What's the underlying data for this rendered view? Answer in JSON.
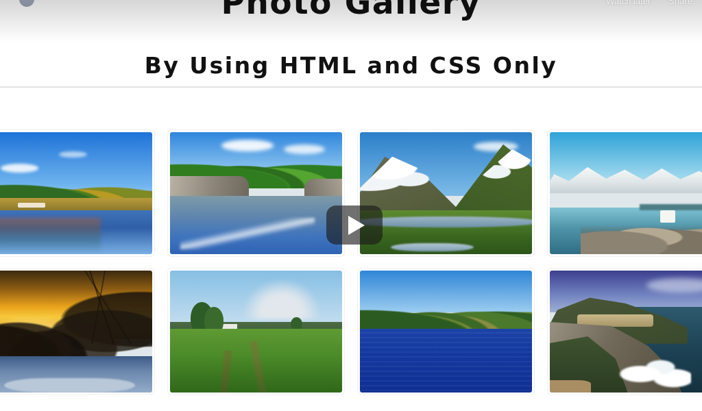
{
  "page": {
    "title": "Photo Gallery",
    "subtitle": "By Using HTML and CSS Only"
  },
  "player": {
    "watch_later_label": "Watch later",
    "share_label": "Share",
    "play_button_label": "Play",
    "avatar_label": "Channel avatar"
  },
  "gallery": {
    "photos": [
      {
        "alt": "Autumn lake with orange and green trees reflected in calm blue water"
      },
      {
        "alt": "River flowing between rocky cliffs lined with green forest under blue sky"
      },
      {
        "alt": "Snow-capped green mountains with a stream winding through a grassy meadow"
      },
      {
        "alt": "Glacier and snowy peaks above a turquoise bay with a rocky shoreline"
      },
      {
        "alt": "Golden winter sunset seen through bare trees above snow-covered ground"
      },
      {
        "alt": "Green farm fields with trees and distant smoke on the horizon"
      },
      {
        "alt": "Deep blue lake bordered by a dense autumn forest shoreline"
      },
      {
        "alt": "Coastal cliffs with green hills and white waves breaking on rocks"
      }
    ]
  },
  "colors": {
    "page_background": "#ffffff",
    "title_text": "#111111",
    "divider": "#e3e3e3",
    "play_button_overlay": "#191919",
    "play_triangle": "#ffffff"
  }
}
